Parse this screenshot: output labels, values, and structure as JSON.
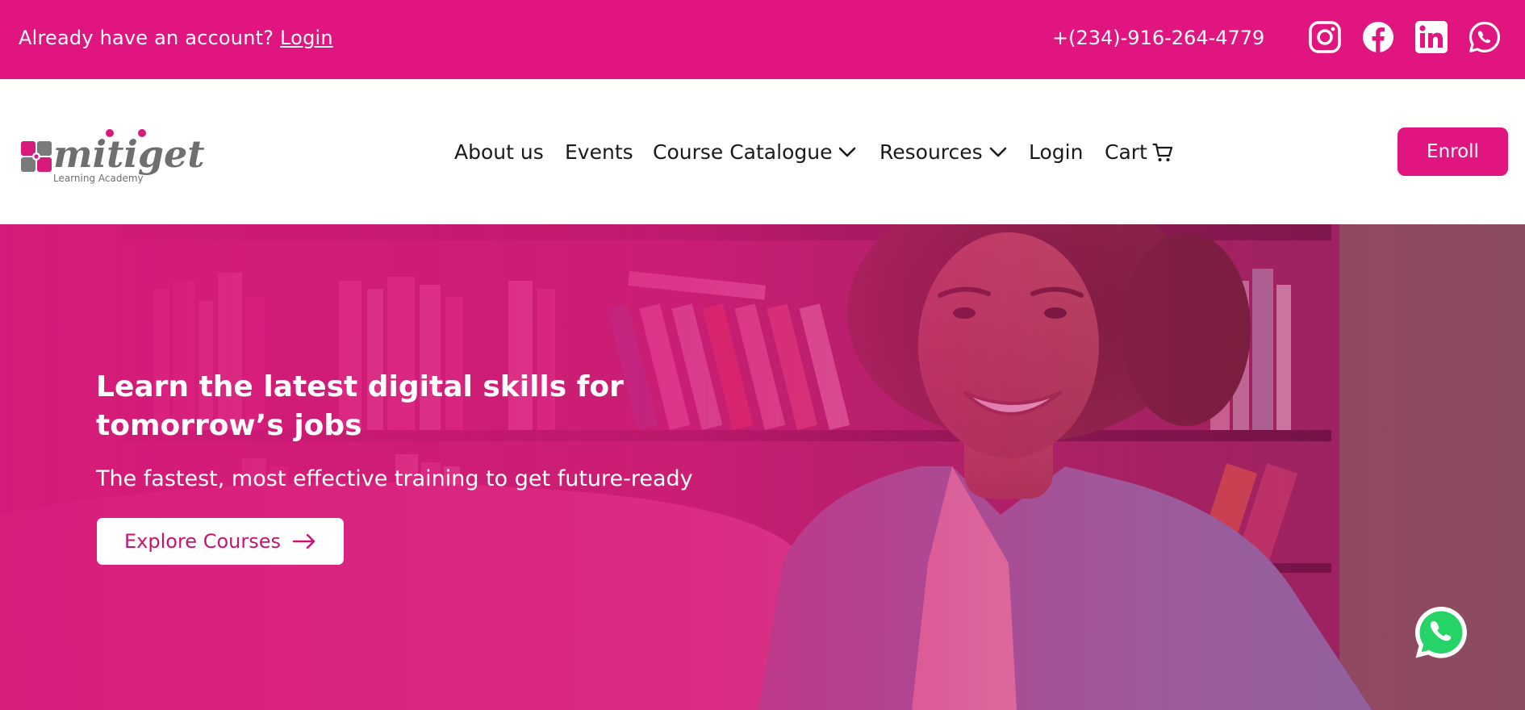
{
  "topbar": {
    "account_prompt": "Already have an account?",
    "login_link": "Login",
    "phone": "+(234)-916-264-4779",
    "social_icons": [
      "instagram-icon",
      "facebook-icon",
      "linkedin-icon",
      "whatsapp-icon"
    ]
  },
  "logo": {
    "wordmark": "mitiget",
    "tagline": "Learning Academy"
  },
  "nav": {
    "about": "About us",
    "events": "Events",
    "catalogue": "Course Catalogue",
    "resources": "Resources",
    "login": "Login",
    "cart": "Cart",
    "enroll": "Enroll"
  },
  "hero": {
    "title_line1": "Learn the latest digital skills for",
    "title_line2": "tomorrow’s jobs",
    "subtitle": "The fastest, most effective training to get future-ready",
    "cta": "Explore Courses"
  },
  "colors": {
    "brand": "#e0157f",
    "hero_overlay": "#d81b7a",
    "white": "#ffffff",
    "whatsapp": "#25d366"
  }
}
